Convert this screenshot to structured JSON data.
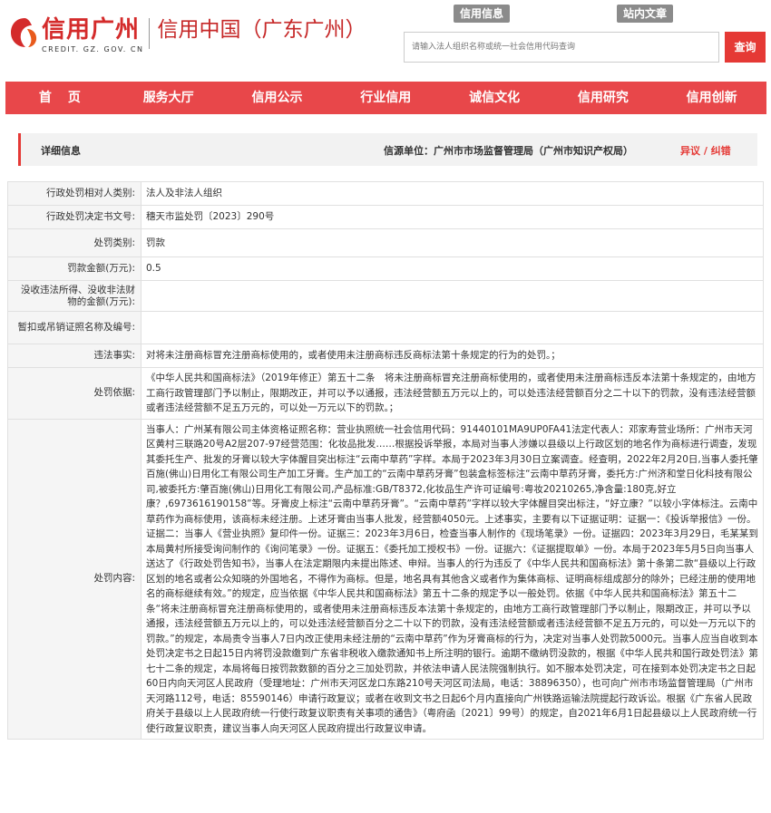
{
  "header": {
    "logo_text": "信用广州",
    "logo_domain": "CREDIT. GZ. GOV. CN",
    "site_name": "信用中国（广东广州）",
    "search_tabs": [
      "信用信息",
      "站内文章"
    ],
    "search_placeholder": "请输入法人组织名称或统一社会信用代码查询",
    "search_button": "查询"
  },
  "nav": {
    "items": [
      "首页",
      "服务大厅",
      "信用公示",
      "行业信用",
      "诚信文化",
      "信用研究",
      "信用创新"
    ]
  },
  "detail": {
    "title": "详细信息",
    "source": "信源单位：广州市市场监督管理局（广州市知识产权局）",
    "objection": "异议 / 纠错"
  },
  "fields": {
    "category": {
      "label": "行政处罚相对人类别:",
      "value": "法人及非法人组织"
    },
    "doc_no": {
      "label": "行政处罚决定书文号:",
      "value": "穗天市监处罚〔2023〕290号"
    },
    "penalty_type": {
      "label": "处罚类别:",
      "value": "罚款"
    },
    "fine_amount": {
      "label": "罚款金额(万元):",
      "value": "0.5"
    },
    "confiscation": {
      "label": "没收违法所得、没收非法财物的金额(万元):",
      "value": ""
    },
    "revoke": {
      "label": "暂扣或吊销证照名称及编号:",
      "value": ""
    },
    "illegal_facts": {
      "label": "违法事实:",
      "value": "对将未注册商标冒充注册商标使用的，或者使用未注册商标违反商标法第十条规定的行为的处罚。；"
    },
    "basis": {
      "label": "处罚依据:",
      "value": "《中华人民共和国商标法》（2019年修正）第五十二条　将未注册商标冒充注册商标使用的，或者使用未注册商标违反本法第十条规定的，由地方工商行政管理部门予以制止，限期改正，并可以予以通报，违法经营额五万元以上的，可以处违法经营额百分之二十以下的罚款，没有违法经营额或者违法经营额不足五万元的，可以处一万元以下的罚款。；"
    },
    "content": {
      "label": "处罚内容:",
      "value": "当事人：广州某有限公司主体资格证照名称：营业执照统一社会信用代码：91440101MA9UP0FA41法定代表人：邓家寿营业场所：广州市天河区黄村三联路20号A2层207-97经营范围：化妆品批发……根据投诉举报，本局对当事人涉嫌以县级以上行政区划的地名作为商标进行调查，发现其委托生产、批发的牙膏以较大字体醒目突出标注“云南中草药”字样。本局于2023年3月30日立案调查。经查明，2022年2月20日,当事人委托肇百施(佛山)日用化工有限公司生产加工牙膏。生产加工的“云南中草药牙膏”包装盒标签标注“云南中草药牙膏，委托方:广州济和堂日化科技有限公司,被委托方:肇百施(佛山)日用化工有限公司,产品标准:GB/T8372,化妆品生产许可证编号:粤妆20210265,净含量:180克,好立康？,6973616190158”等。牙膏皮上标注“云南中草药牙膏”。“云南中草药”字样以较大字体醒目突出标注，“好立康？”以较小字体标注。云南中草药作为商标使用，该商标未经注册。上述牙膏由当事人批发，经营额4050元。上述事实，主要有以下证据证明：证据一：《投诉举报信》一份。证据二：当事人《营业执照》复印件一份。证据三：2023年3月6日，检查当事人制作的《现场笔录》一份。证据四：2023年3月29日，毛某某到本局黄村所接受询问制作的《询问笔录》一份。证据五：《委托加工授权书》一份。证据六：《证据提取单》一份。本局于2023年5月5日向当事人送达了《行政处罚告知书》，当事人在法定期限内未提出陈述、申辩。当事人的行为违反了《中华人民共和国商标法》第十条第二款“县级以上行政区划的地名或者公众知晓的外国地名，不得作为商标。但是，地名具有其他含义或者作为集体商标、证明商标组成部分的除外；已经注册的使用地名的商标继续有效。”的规定，应当依据《中华人民共和国商标法》第五十二条的规定予以一般处罚。依据《中华人民共和国商标法》第五十二条“将未注册商标冒充注册商标使用的，或者使用未注册商标违反本法第十条规定的，由地方工商行政管理部门予以制止，限期改正，并可以予以通报，违法经营额五万元以上的，可以处违法经营额百分之二十以下的罚款，没有违法经营额或者违法经营额不足五万元的，可以处一万元以下的罚款。”的规定，本局责令当事人7日内改正使用未经注册的“云南中草药”作为牙膏商标的行为，决定对当事人处罚款5000元。当事人应当自收到本处罚决定书之日起15日内将罚没款缴到广东省非税收入缴款通知书上所注明的银行。逾期不缴纳罚没款的，根据《中华人民共和国行政处罚法》第七十二条的规定，本局将每日按罚款数额的百分之三加处罚款，并依法申请人民法院强制执行。如不服本处罚决定，可在接到本处罚决定书之日起60日内向天河区人民政府（受理地址：广州市天河区龙口东路210号天河区司法局，电话：38896350），也可向广州市市场监督管理局（广州市天河路112号，电话：85590146）申请行政复议；或者在收到文书之日起6个月内直接向广州铁路运输法院提起行政诉讼。根据《广东省人民政府关于县级以上人民政府统一行使行政复议职责有关事项的通告》（粤府函〔2021〕99号）的规定，自2021年6月1日起县级以上人民政府统一行使行政复议职责，建议当事人向天河区人民政府提出行政复议申请。"
    }
  },
  "colors": {
    "brand_red": "#e8474a",
    "button_red": "#e53935",
    "tab_gray": "#8b8b8b"
  }
}
